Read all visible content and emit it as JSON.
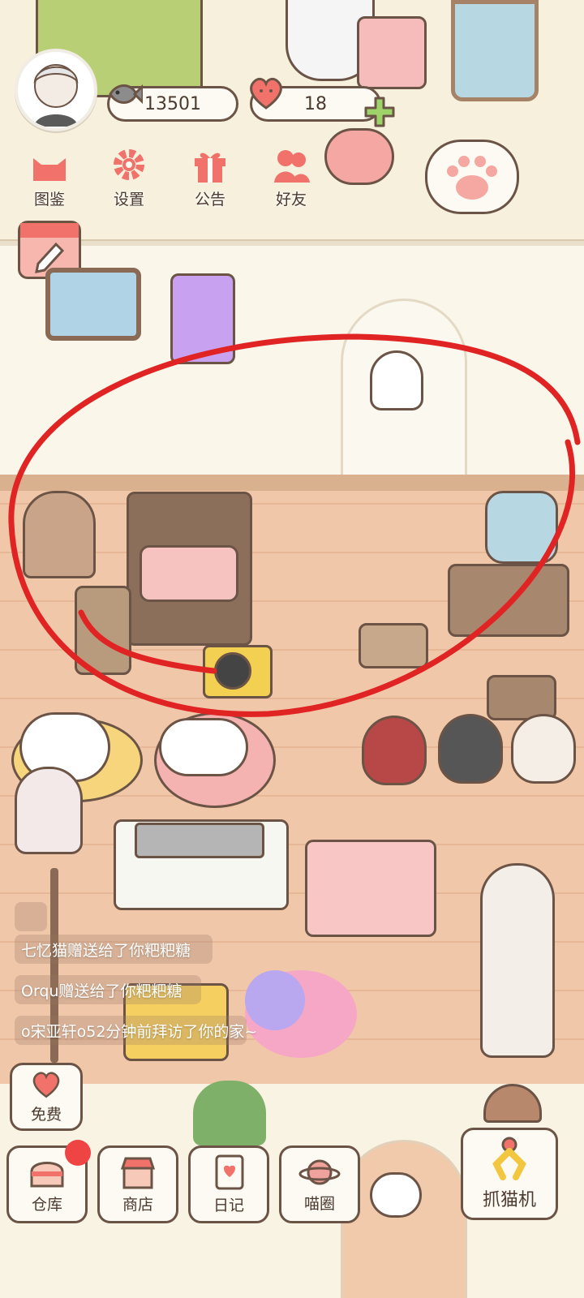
{
  "hud": {
    "fish_count": "13501",
    "heart_count": "18"
  },
  "top_menu": {
    "gallery": "图鉴",
    "settings": "设置",
    "notice": "公告",
    "friends": "好友"
  },
  "feed": [
    "",
    "七忆猫赠送给了你粑粑糖",
    "Orqu赠送给了你粑粑糖",
    "o宋亚轩o52分钟前拜访了你的家~"
  ],
  "bottom_menu": {
    "free": "免费",
    "warehouse": "仓库",
    "shop": "商店",
    "diary": "日记",
    "meow_circle": "喵圈",
    "claw_machine": "抓猫机"
  },
  "colors": {
    "accent_pink": "#f0726b",
    "annotation_red": "#e02424",
    "outline_brown": "#6b5446",
    "notification_red": "#ef4444"
  },
  "icons": [
    "fish-icon",
    "heart-icon",
    "plus-icon",
    "cat-head-icon",
    "gear-icon",
    "gift-icon",
    "friends-icon",
    "paw-icon",
    "pencil-icon",
    "house-icon",
    "shop-icon",
    "diary-icon",
    "planet-icon",
    "claw-icon"
  ]
}
